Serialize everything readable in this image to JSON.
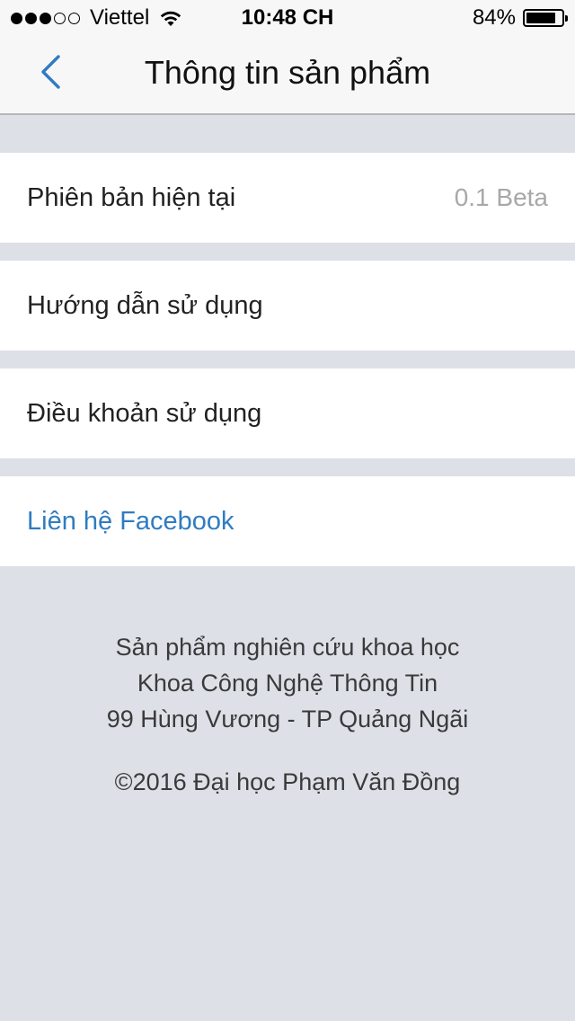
{
  "status_bar": {
    "carrier": "Viettel",
    "signal_bars": 3,
    "signal_total": 5,
    "time": "10:48 CH",
    "battery_percent": "84%",
    "battery_level": 0.84
  },
  "nav": {
    "title": "Thông tin sản phẩm",
    "back_icon": "chevron-left-icon"
  },
  "rows": [
    {
      "label": "Phiên bản hiện tại",
      "value": "0.1 Beta"
    },
    {
      "label": "Hướng dẫn sử dụng"
    },
    {
      "label": "Điều khoản sử dụng"
    },
    {
      "label": "Liên hệ Facebook"
    }
  ],
  "footer": {
    "line1": "Sản phẩm nghiên cứu khoa học",
    "line2": "Khoa Công Nghệ Thông Tin",
    "line3": "99 Hùng Vương - TP Quảng Ngãi",
    "copyright": "©2016 Đại học Phạm Văn Đồng"
  },
  "colors": {
    "accent": "#2f7cc1",
    "background": "#dde0e7",
    "nav_background": "#f7f7f7",
    "row_background": "#ffffff",
    "value_text": "#a8a8a8"
  }
}
